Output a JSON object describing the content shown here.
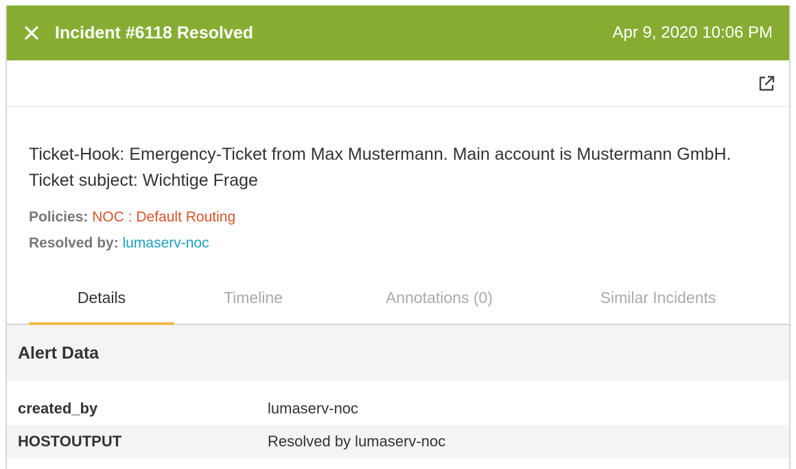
{
  "header": {
    "title": "Incident #6118 Resolved",
    "timestamp": "Apr 9, 2020 10:06 PM",
    "background_color": "#86ad31",
    "close_icon": "close-icon"
  },
  "toolbar": {
    "external_link_icon": "external-link-icon"
  },
  "incident": {
    "summary": "Ticket-Hook: Emergency-Ticket from Max Mustermann. Main account is Mustermann GmbH. Ticket subject: Wichtige Frage",
    "policies_label": "Policies:",
    "policies_value": "NOC : Default Routing",
    "resolved_by_label": "Resolved by:",
    "resolved_by_value": "lumaserv-noc"
  },
  "tabs": [
    {
      "label": "Details",
      "active": true
    },
    {
      "label": "Timeline",
      "active": false
    },
    {
      "label": "Annotations (0)",
      "active": false
    },
    {
      "label": "Similar Incidents",
      "active": false
    }
  ],
  "alert_data": {
    "title": "Alert Data",
    "rows": [
      {
        "key": "created_by",
        "value": "lumaserv-noc"
      },
      {
        "key": "HOSTOUTPUT",
        "value": "Resolved by lumaserv-noc"
      }
    ]
  },
  "colors": {
    "accent_tab": "#f0b849",
    "policy_link": "#d9532a",
    "user_link": "#1a9fc0"
  }
}
